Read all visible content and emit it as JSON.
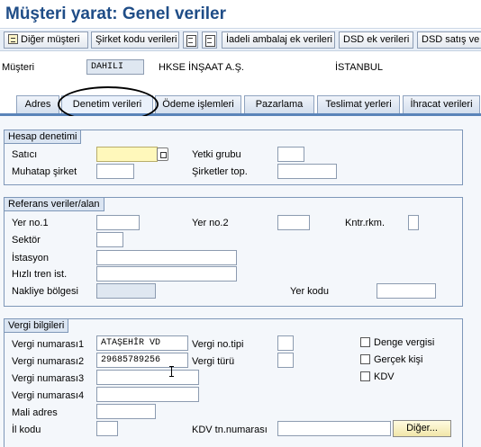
{
  "window": {
    "title": "Müşteri yarat: Genel veriler"
  },
  "toolbar": {
    "buttons": [
      "Diğer müşteri",
      "Şirket kodu verileri",
      "İadeli ambalaj ek verileri",
      "DSD ek verileri",
      "DSD satış ve"
    ]
  },
  "header": {
    "label": "Müşteri",
    "customer_id": "DAHILI",
    "name": "HKSE İNŞAAT A.Ş.",
    "city": "İSTANBUL"
  },
  "tabs": [
    "Adres",
    "Denetim verileri",
    "Ödeme işlemleri",
    "Pazarlama",
    "Teslimat yerleri",
    "İhracat verileri"
  ],
  "active_tab": "Denetim verileri",
  "hesap": {
    "title": "Hesap denetimi",
    "satici": "Satıcı",
    "muhatap": "Muhatap şirket",
    "yetki": "Yetki grubu",
    "sirketler": "Şirketler top."
  },
  "referans": {
    "title": "Referans veriler/alan",
    "yer1": "Yer no.1",
    "yer2": "Yer no.2",
    "kntr": "Kntr.rkm.",
    "sektor": "Sektör",
    "istasyon": "İstasyon",
    "hizli": "Hızlı tren ist.",
    "nakliye": "Nakliye bölgesi",
    "yerkodu": "Yer kodu"
  },
  "vergi": {
    "title": "Vergi bilgileri",
    "vn1": "Vergi numarası1",
    "vn1_value": "ATAŞEHİR VD",
    "vn2": "Vergi numarası2",
    "vn2_value": "29685789256",
    "vn3": "Vergi numarası3",
    "vn4": "Vergi numarası4",
    "mali": "Mali adres",
    "il": "İl kodu",
    "notipi": "Vergi no.tipi",
    "turu": "Vergi türü",
    "kdvtn": "KDV tn.numarası",
    "denge": "Denge vergisi",
    "gercek": "Gerçek kişi",
    "kdv": "KDV",
    "diger": "Diğer..."
  }
}
